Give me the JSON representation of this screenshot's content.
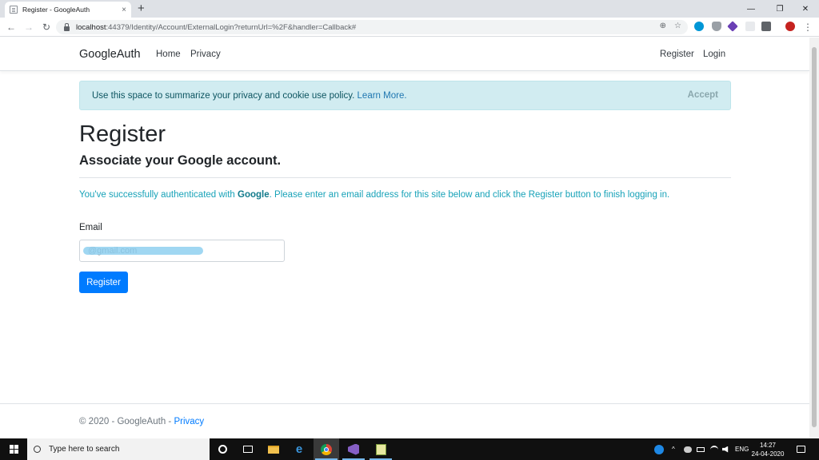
{
  "browser": {
    "tab_title": "Register - GoogleAuth",
    "tab_close": "×",
    "new_tab": "+",
    "url_host": "localhost",
    "url_rest": ":44379/Identity/Account/ExternalLogin?returnUrl=%2F&handler=Callback#",
    "window_controls": {
      "minimize": "—",
      "restore": "❐",
      "close": "✕"
    },
    "nav": {
      "back": "←",
      "forward": "→",
      "reload": "↻"
    },
    "omni_icons": {
      "zoom": "⊕",
      "star": "☆"
    },
    "menu": "⋮"
  },
  "navbar": {
    "brand": "GoogleAuth",
    "links": [
      "Home",
      "Privacy"
    ],
    "right_links": [
      "Register",
      "Login"
    ]
  },
  "cookie": {
    "message": "Use this space to summarize your privacy and cookie use policy.",
    "learn_more": "Learn More.",
    "accept": "Accept"
  },
  "main": {
    "title": "Register",
    "subtitle": "Associate your Google account.",
    "info_before": "You've successfully authenticated with ",
    "info_provider": "Google",
    "info_after": ". Please enter an email address for this site below and click the Register button to finish logging in.",
    "email_label": "Email",
    "email_value": "@gmail.com",
    "register_button": "Register"
  },
  "footer": {
    "text": "© 2020 - GoogleAuth - ",
    "privacy": "Privacy"
  },
  "taskbar": {
    "search_placeholder": "Type here to search",
    "language": "ENG",
    "time": "14:27",
    "date": "24-04-2020"
  },
  "colors": {
    "primary": "#007bff",
    "alert_bg": "#d1ecf1",
    "info_text": "#17a2b8"
  }
}
